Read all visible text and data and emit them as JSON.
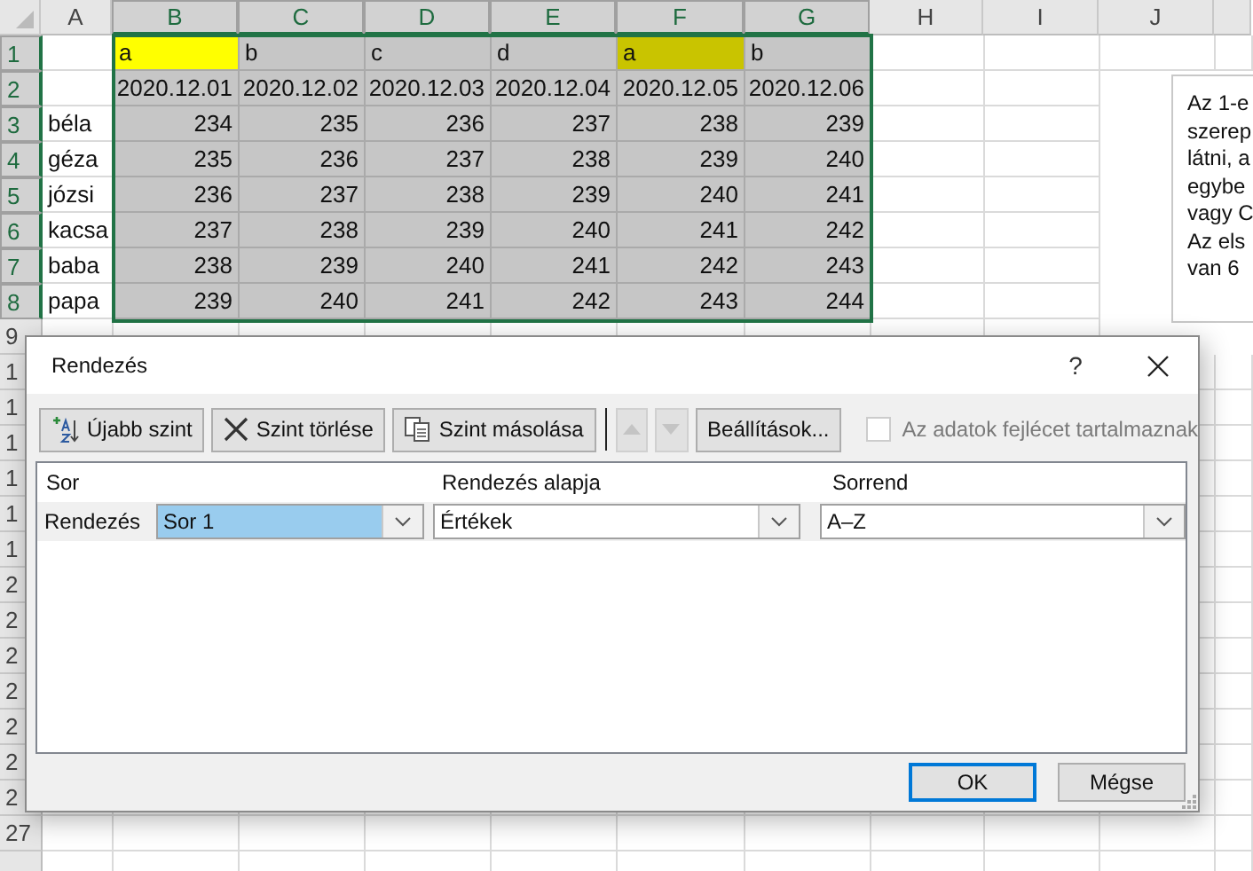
{
  "sheet": {
    "columns": [
      {
        "label": "A",
        "selected": false
      },
      {
        "label": "B",
        "selected": true
      },
      {
        "label": "C",
        "selected": true
      },
      {
        "label": "D",
        "selected": true
      },
      {
        "label": "E",
        "selected": true
      },
      {
        "label": "F",
        "selected": true
      },
      {
        "label": "G",
        "selected": true
      },
      {
        "label": "H",
        "selected": false
      },
      {
        "label": "I",
        "selected": false
      },
      {
        "label": "J",
        "selected": false
      }
    ],
    "row_headers": [
      {
        "label": "1",
        "selected": true
      },
      {
        "label": "2",
        "selected": true
      },
      {
        "label": "3",
        "selected": true
      },
      {
        "label": "4",
        "selected": true
      },
      {
        "label": "5",
        "selected": true
      },
      {
        "label": "6",
        "selected": true
      },
      {
        "label": "7",
        "selected": true
      },
      {
        "label": "8",
        "selected": true
      },
      {
        "label": "9",
        "selected": false
      },
      {
        "label": "1",
        "selected": false
      },
      {
        "label": "1",
        "selected": false
      },
      {
        "label": "1",
        "selected": false
      },
      {
        "label": "1",
        "selected": false
      },
      {
        "label": "1",
        "selected": false
      },
      {
        "label": "1",
        "selected": false
      },
      {
        "label": "2",
        "selected": false
      },
      {
        "label": "2",
        "selected": false
      },
      {
        "label": "2",
        "selected": false
      },
      {
        "label": "2",
        "selected": false
      },
      {
        "label": "2",
        "selected": false
      },
      {
        "label": "2",
        "selected": false
      },
      {
        "label": "2",
        "selected": false
      },
      {
        "label": "27",
        "selected": false
      }
    ],
    "header_row": [
      {
        "text": "a",
        "color": "#ffff00"
      },
      {
        "text": "b",
        "color": "#c6c6c6"
      },
      {
        "text": "c",
        "color": "#c6c6c6"
      },
      {
        "text": "d",
        "color": "#c6c6c6"
      },
      {
        "text": "a",
        "color": "#c9c400"
      },
      {
        "text": "b",
        "color": "#c6c6c6"
      }
    ],
    "date_row": [
      "2020.12.01",
      "2020.12.02",
      "2020.12.03",
      "2020.12.04",
      "2020.12.05",
      "2020.12.06"
    ],
    "rows": [
      {
        "name": "béla",
        "values": [
          "234",
          "235",
          "236",
          "237",
          "238",
          "239"
        ]
      },
      {
        "name": "géza",
        "values": [
          "235",
          "236",
          "237",
          "238",
          "239",
          "240"
        ]
      },
      {
        "name": "józsi",
        "values": [
          "236",
          "237",
          "238",
          "239",
          "240",
          "241"
        ]
      },
      {
        "name": "kacsa",
        "values": [
          "237",
          "238",
          "239",
          "240",
          "241",
          "242"
        ]
      },
      {
        "name": "baba",
        "values": [
          "238",
          "239",
          "240",
          "241",
          "242",
          "243"
        ]
      },
      {
        "name": "papa",
        "values": [
          "239",
          "240",
          "241",
          "242",
          "243",
          "244"
        ]
      }
    ]
  },
  "text_box": {
    "lines": [
      "Az 1-e",
      "szerep",
      "látni, a",
      "egybe",
      "vagy C",
      "Az els",
      "van 6"
    ]
  },
  "dialog": {
    "title": "Rendezés",
    "help": "?",
    "toolbar": [
      {
        "kind": "add_level",
        "label": "Újabb szint",
        "disabled": false
      },
      {
        "kind": "delete_level",
        "label": "Szint törlése",
        "disabled": false
      },
      {
        "kind": "copy_level",
        "label": "Szint másolása",
        "disabled": false
      },
      {
        "kind": "move_up",
        "disabled": true
      },
      {
        "kind": "move_down",
        "disabled": true
      },
      {
        "kind": "options",
        "label": "Beállítások...",
        "disabled": false
      }
    ],
    "header_checkbox": {
      "label": "Az adatok fejlécet tartalmaznak",
      "checked": false,
      "disabled": true
    },
    "columns": [
      "Sor",
      "Rendezés alapja",
      "Sorrend"
    ],
    "levels": [
      {
        "label": "Rendezés",
        "column": "Sor 1",
        "column_selected": true,
        "sort_on": "Értékek",
        "order": "A–Z"
      }
    ],
    "buttons": [
      {
        "label": "OK",
        "default": true
      },
      {
        "label": "Mégse",
        "default": false
      }
    ]
  }
}
